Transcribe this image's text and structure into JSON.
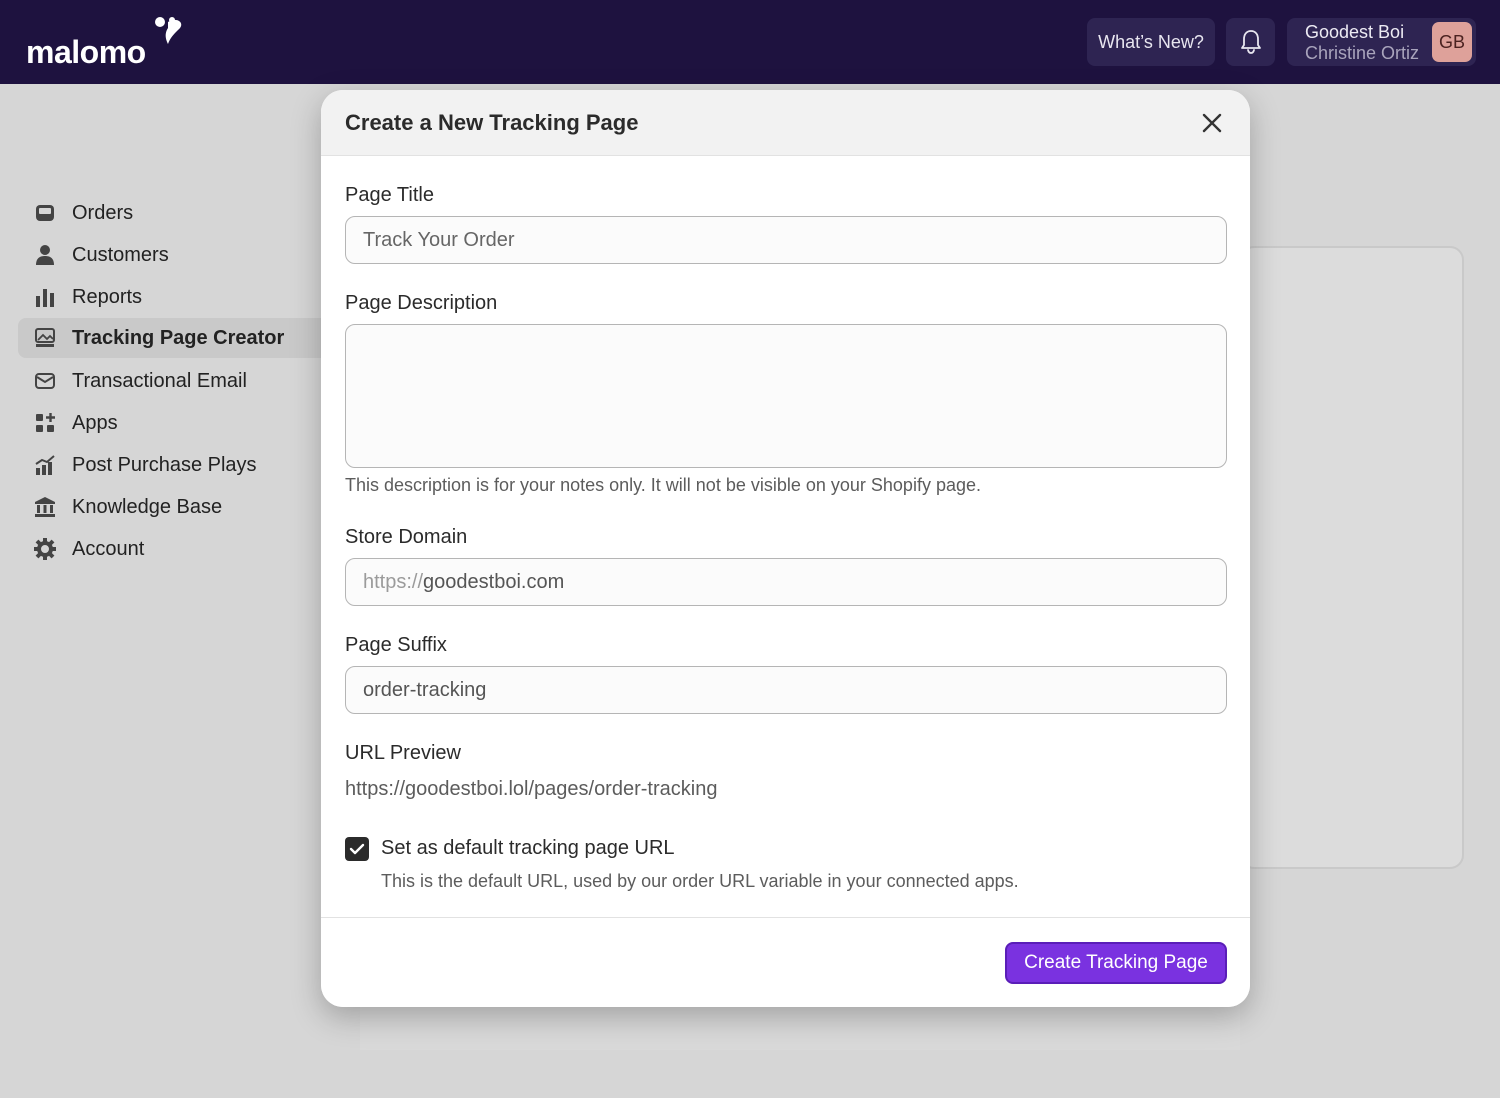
{
  "app": {
    "logo_text": "malomo"
  },
  "topbar": {
    "whats_new_label": "What’s New?",
    "user": {
      "store": "Goodest Boi",
      "name": "Christine Ortiz",
      "initials": "GB"
    }
  },
  "sidebar": {
    "items": [
      {
        "label": "Orders",
        "icon": "inbox-icon"
      },
      {
        "label": "Customers",
        "icon": "person-icon"
      },
      {
        "label": "Reports",
        "icon": "bar-chart-icon"
      },
      {
        "label": "Tracking Page Creator",
        "icon": "page-image-icon",
        "active": true
      },
      {
        "label": "Transactional Email",
        "icon": "envelope-icon"
      },
      {
        "label": "Apps",
        "icon": "apps-grid-icon"
      },
      {
        "label": "Post Purchase Plays",
        "icon": "growth-chart-icon"
      },
      {
        "label": "Knowledge Base",
        "icon": "bank-icon"
      },
      {
        "label": "Account",
        "icon": "gear-icon"
      }
    ]
  },
  "modal": {
    "title": "Create a New Tracking Page",
    "page_title": {
      "label": "Page Title",
      "placeholder": "Track Your Order"
    },
    "page_description": {
      "label": "Page Description",
      "value": "",
      "help": "This description is for your notes only. It will not be visible on your Shopify page."
    },
    "store_domain": {
      "label": "Store Domain",
      "prefix": "https://",
      "value": "goodestboi.com"
    },
    "page_suffix": {
      "label": "Page Suffix",
      "value": "order-tracking"
    },
    "url_preview": {
      "label": "URL Preview",
      "value": "https://goodestboi.lol/pages/order-tracking"
    },
    "default_checkbox": {
      "checked": true,
      "label": "Set as default tracking page URL",
      "help": "This is the default URL, used by our order URL variable in your connected apps."
    },
    "submit_label": "Create Tracking Page"
  },
  "colors": {
    "topbar": "#1e123f",
    "accent": "#7a32e0",
    "avatar": "#dea19a"
  }
}
